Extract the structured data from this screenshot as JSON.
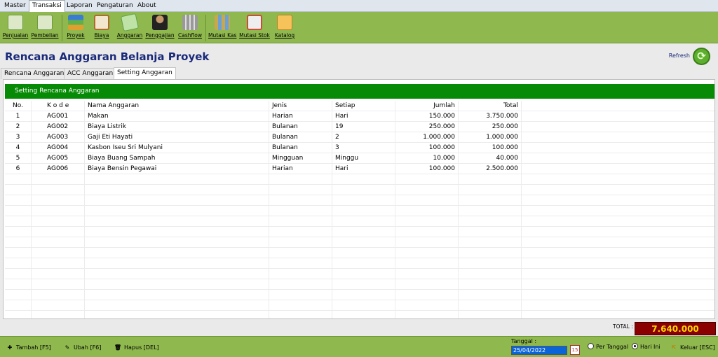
{
  "menu": [
    "Master",
    "Transaksi",
    "Laporan",
    "Pengaturan",
    "About"
  ],
  "toolbar": [
    {
      "label": "Penjualan",
      "icon": "cart-sell-icon",
      "color": "#6d9a3d"
    },
    {
      "label": "Pembelian",
      "icon": "cart-buy-icon",
      "color": "#6d9a3d"
    },
    {
      "label": "Proyek",
      "icon": "project-stack-icon",
      "color": "#3a7bd5"
    },
    {
      "label": "Biaya",
      "icon": "cost-book-icon",
      "color": "#b06a2c"
    },
    {
      "label": "Anggaran",
      "icon": "budget-money-icon",
      "color": "#5ea24a"
    },
    {
      "label": "Penggajian",
      "icon": "payroll-person-icon",
      "color": "#333333"
    },
    {
      "label": "Cashflow",
      "icon": "cashflow-icon",
      "color": "#777777"
    },
    {
      "label": "Mutasi Kas",
      "icon": "cash-mutation-icon",
      "color": "#c8a84b"
    },
    {
      "label": "Mutasi Stok",
      "icon": "stock-mutation-icon",
      "color": "#d04a3a"
    },
    {
      "label": "Katalog",
      "icon": "catalog-icon",
      "color": "#e3a52b"
    }
  ],
  "page": {
    "title": "Rencana Anggaran Belanja Proyek",
    "refresh_label": "Refresh"
  },
  "tabs": [
    "Rencana Anggaran",
    "ACC Anggaran",
    "Setting Anggaran"
  ],
  "panel": {
    "title": "Setting Rencana Anggaran"
  },
  "table": {
    "headers": [
      "No.",
      "K o d e",
      "Nama Anggaran",
      "Jenis",
      "Setiap",
      "Jumlah",
      "Total"
    ],
    "rows": [
      [
        "1",
        "AG001",
        "Makan",
        "Harian",
        "Hari",
        "150.000",
        "3.750.000"
      ],
      [
        "2",
        "AG002",
        "Biaya Listrik",
        "Bulanan",
        "19",
        "250.000",
        "250.000"
      ],
      [
        "3",
        "AG003",
        "Gaji Eti Hayati",
        "Bulanan",
        "2",
        "1.000.000",
        "1.000.000"
      ],
      [
        "4",
        "AG004",
        "Kasbon Iseu Sri Mulyani",
        "Bulanan",
        "3",
        "100.000",
        "100.000"
      ],
      [
        "5",
        "AG005",
        "Biaya Buang Sampah",
        "Mingguan",
        "Minggu",
        "10.000",
        "40.000"
      ],
      [
        "6",
        "AG006",
        "Biaya Bensin Pegawai",
        "Harian",
        "Hari",
        "100.000",
        "2.500.000"
      ]
    ]
  },
  "total": {
    "label": "TOTAL :",
    "value": "7.640.000"
  },
  "bottom": {
    "add_label": "Tambah [F5]",
    "edit_label": "Ubah [F6]",
    "delete_label": "Hapus [DEL]",
    "date_label": "Tanggal :",
    "date_value": "25/04/2022",
    "calendar_day": "15",
    "radio_per_tanggal": "Per Tanggal",
    "radio_hari_ini": "Hari Ini",
    "exit_label": "Keluar [ESC]"
  }
}
